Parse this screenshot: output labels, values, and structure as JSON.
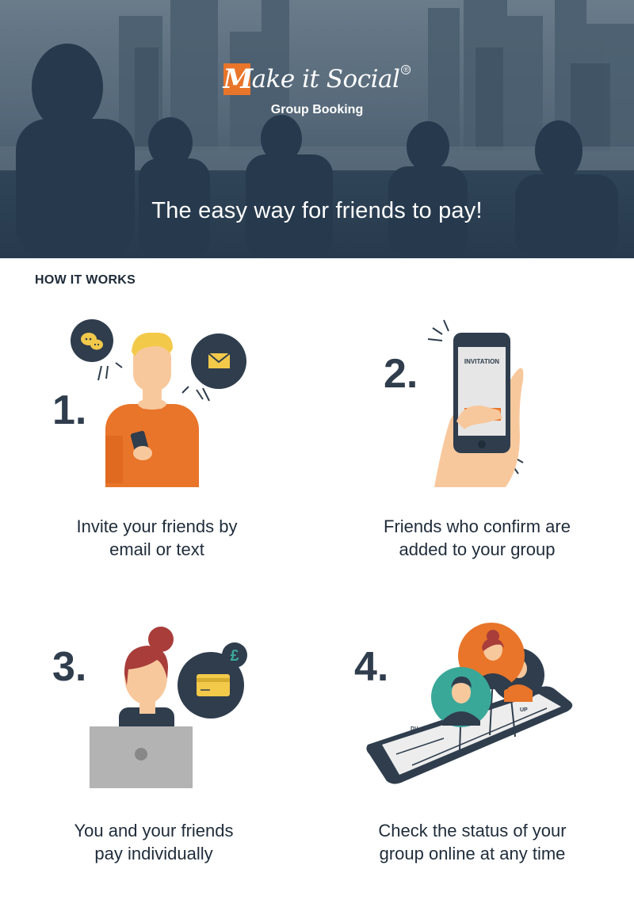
{
  "hero": {
    "brand_initial": "M",
    "brand_rest": "ake it Social",
    "registered": "®",
    "subtitle": "Group Booking",
    "tagline": "The easy way for friends to pay!"
  },
  "section_title": "HOW IT WORKS",
  "steps": [
    {
      "number": "1.",
      "caption_line1": "Invite your friends by",
      "caption_line2": "email or text"
    },
    {
      "number": "2.",
      "caption_line1": "Friends who confirm are",
      "caption_line2": "added to your group",
      "phone_text": "INVITATION"
    },
    {
      "number": "3.",
      "caption_line1": "You and your friends",
      "caption_line2": "pay individually",
      "currency": "£"
    },
    {
      "number": "4.",
      "caption_line1": "Check the status of your",
      "caption_line2": "group online at any time",
      "phone_label_a": "DV",
      "phone_label_b": "UP"
    }
  ],
  "colors": {
    "navy": "#2f3d4d",
    "orange": "#e8752a",
    "yellow": "#f3c94a",
    "teal": "#3aa899",
    "skin": "#f8c89d"
  }
}
